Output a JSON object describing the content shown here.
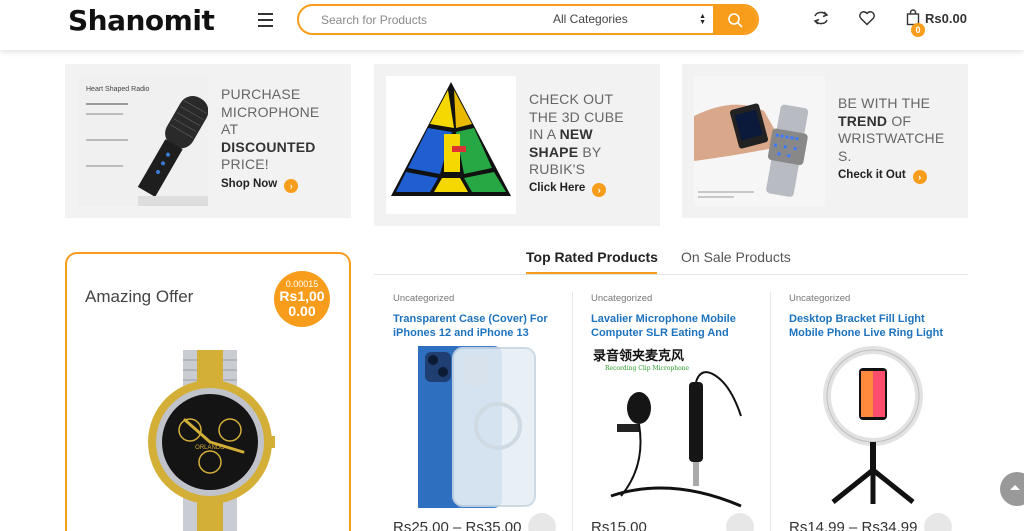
{
  "header": {
    "logo": "Shanomit",
    "search_placeholder": "Search for Products",
    "category_selected": "All Categories",
    "cart_total": "Rs0.00",
    "cart_count": "0",
    "accent_color": "#f89d1b"
  },
  "promos": [
    {
      "line1": "PURCHASE",
      "line2": "MICROPHONE",
      "line3": "AT",
      "bold": "DISCOUNTED",
      "line5": "PRICE!",
      "cta": "Shop Now",
      "image_title": "Heart Shaped Radio"
    },
    {
      "line1": "CHECK OUT",
      "line2": "THE 3D CUBE",
      "line3_pre": "IN A ",
      "line3_bold": "NEW",
      "line4_bold": "SHAPE",
      "line4_post": " BY",
      "line5": "RUBIK'S",
      "cta": "Click Here"
    },
    {
      "line1": "BE WITH THE",
      "line2_bold": "TREND",
      "line2_post": " OF",
      "line3": "WRISTWATCHE",
      "line4": "S.",
      "cta": "Check it Out"
    }
  ],
  "offer": {
    "title": "Amazing Offer",
    "old_price": "0.00015",
    "new_price_line1": "Rs1,00",
    "new_price_line2": "0.00",
    "watch_brand": "ORLANDO"
  },
  "tabs": [
    {
      "label": "Top Rated Products",
      "active": true
    },
    {
      "label": "On Sale Products",
      "active": false
    }
  ],
  "products": [
    {
      "category": "Uncategorized",
      "name": "Transparent Case (Cover) For iPhones 12 and iPhone 13",
      "price": "Rs25.00 – Rs35.00"
    },
    {
      "category": "Uncategorized",
      "name": "Lavalier Microphone Mobile Computer SLR Eating And",
      "price": "Rs15.00",
      "image_caption": "录音领夹麦克风",
      "image_subcaption": "Recording Clip Microphone"
    },
    {
      "category": "Uncategorized",
      "name": "Desktop Bracket Fill Light Mobile Phone Live Ring Light",
      "price": "Rs14.99 – Rs34.99"
    }
  ]
}
